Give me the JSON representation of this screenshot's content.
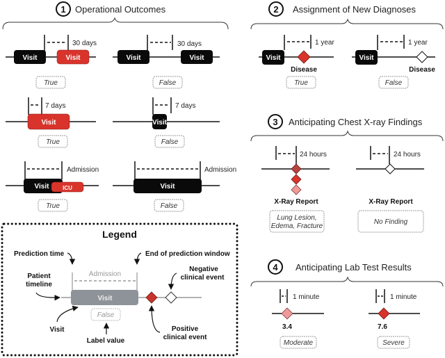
{
  "colors": {
    "visit_black": "#0a0a0a",
    "visit_red": "#d8342c",
    "legend_gray": "#8e9399",
    "diamond_dark": "#b84440",
    "diamond_red": "#d8342c",
    "diamond_light": "#ef9a98"
  },
  "sections": [
    {
      "number": "1",
      "title": "Operational Outcomes",
      "examples": [
        {
          "window": "30 days",
          "boxes": [
            "Visit",
            "Visit"
          ],
          "label": "True"
        },
        {
          "window": "30 days",
          "boxes": [
            "Visit",
            "Visit"
          ],
          "label": "False"
        },
        {
          "window": "7 days",
          "boxes": [
            "Visit"
          ],
          "label": "True"
        },
        {
          "window": "7 days",
          "boxes": [
            "Visit"
          ],
          "label": "False"
        },
        {
          "window": "Admission",
          "boxes": [
            "Visit",
            "ICU"
          ],
          "label": "True"
        },
        {
          "window": "Admission",
          "boxes": [
            "Visit"
          ],
          "label": "False"
        }
      ]
    },
    {
      "number": "2",
      "title": "Assignment of New Diagnoses",
      "examples": [
        {
          "window": "1 year",
          "boxes": [
            "Visit"
          ],
          "event": "Disease",
          "label": "True"
        },
        {
          "window": "1 year",
          "boxes": [
            "Visit"
          ],
          "event": "Disease",
          "label": "False"
        }
      ]
    },
    {
      "number": "3",
      "title": "Anticipating Chest X-ray Findings",
      "examples": [
        {
          "window": "24 hours",
          "event": "X-Ray Report",
          "label_line1": "Lung Lesion,",
          "label_line2": "Edema, Fracture"
        },
        {
          "window": "24 hours",
          "event": "X-Ray Report",
          "label": "No Finding"
        }
      ]
    },
    {
      "number": "4",
      "title": "Anticipating Lab Test Results",
      "examples": [
        {
          "window": "1 minute",
          "value": "3.4",
          "label": "Moderate"
        },
        {
          "window": "1 minute",
          "value": "7.6",
          "label": "Severe"
        }
      ]
    }
  ],
  "legend": {
    "title": "Legend",
    "prediction_time": "Prediction time",
    "end_window": "End of prediction window",
    "patient_timeline_1": "Patient",
    "patient_timeline_2": "timeline",
    "window_label": "Admission",
    "visit_box": "Visit",
    "label_box": "False",
    "visit": "Visit",
    "label_value": "Label value",
    "negative_1": "Negative",
    "negative_2": "clinical event",
    "positive_1": "Positive",
    "positive_2": "clinical event"
  }
}
